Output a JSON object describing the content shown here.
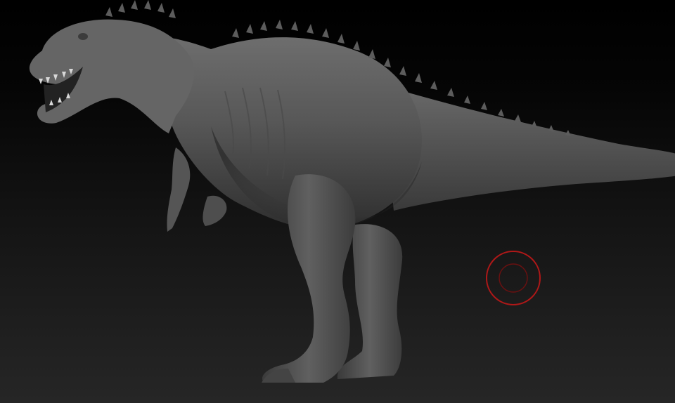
{
  "viewport": {
    "background_top": "#000000",
    "background_bottom": "#262626"
  },
  "model": {
    "icon": "dinosaur-sculpt",
    "material_color": "#5a5a5a"
  },
  "brush": {
    "icon": "brush-cursor-icon",
    "ring_color": "#b01818"
  }
}
